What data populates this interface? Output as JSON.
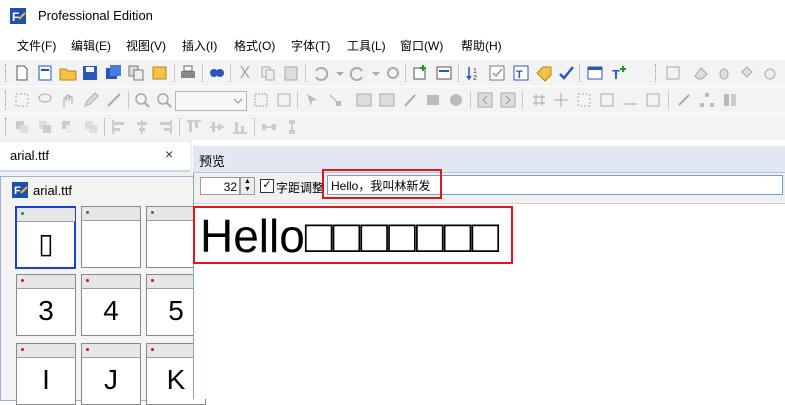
{
  "window": {
    "title": "Professional Edition",
    "icon": "app-logo-icon"
  },
  "menu": [
    "文件(F)",
    "编辑(E)",
    "视图(V)",
    "插入(I)",
    "格式(O)",
    "字体(T)",
    "工具(L)",
    "窗口(W)",
    "帮助(H)"
  ],
  "toolbar": {
    "zoom_value": ""
  },
  "tabs": {
    "file_tab": "arial.ttf",
    "close_glyph": "×"
  },
  "font_window": {
    "title": "arial.ttf",
    "glyphs": [
      {
        "char": "▯",
        "marker": "green",
        "selected": true
      },
      {
        "char": "",
        "marker": "green",
        "selected": false
      },
      {
        "char": "",
        "marker": "green",
        "selected": false
      },
      {
        "char": "3",
        "marker": "red",
        "selected": false
      },
      {
        "char": "4",
        "marker": "red",
        "selected": false
      },
      {
        "char": "5",
        "marker": "red",
        "selected": false
      },
      {
        "char": "I",
        "marker": "red",
        "selected": false
      },
      {
        "char": "J",
        "marker": "red",
        "selected": false
      },
      {
        "char": "K",
        "marker": "red",
        "selected": false
      }
    ]
  },
  "preview": {
    "title": "预览",
    "font_size": "32",
    "spin_up": "▲",
    "spin_down": "▼",
    "kerning_checked": "✓",
    "kerning_label": "字距调整",
    "text_input": "Hello，我叫林新发",
    "rendered_sample": "Hello□□□□□□□"
  },
  "colors": {
    "highlight_red": "#e0161d",
    "marker_green": "#1f8f2a",
    "marker_red": "#d01818",
    "selection_blue": "#1c3fd6"
  }
}
